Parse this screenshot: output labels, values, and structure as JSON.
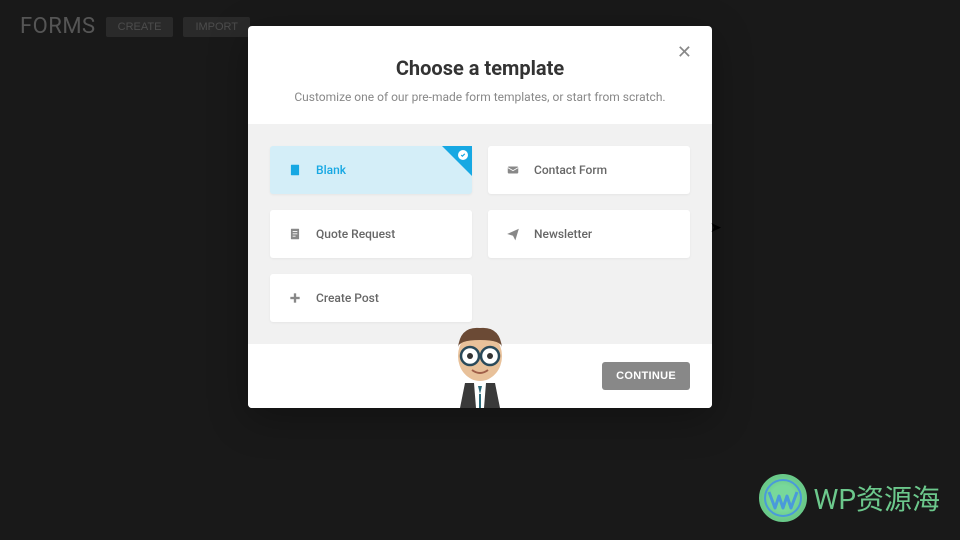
{
  "page": {
    "title": "FORMS",
    "buttons": [
      "CREATE",
      "IMPORT"
    ]
  },
  "modal": {
    "title": "Choose a template",
    "subtitle": "Customize one of our pre-made form templates, or start from scratch.",
    "continue_label": "CONTINUE"
  },
  "templates": [
    {
      "icon": "file-icon",
      "label": "Blank",
      "selected": true
    },
    {
      "icon": "mail-icon",
      "label": "Contact Form",
      "selected": false
    },
    {
      "icon": "document-icon",
      "label": "Quote Request",
      "selected": false
    },
    {
      "icon": "send-icon",
      "label": "Newsletter",
      "selected": false
    },
    {
      "icon": "plus-icon",
      "label": "Create Post",
      "selected": false
    }
  ],
  "watermark": {
    "text": "WP资源海"
  }
}
